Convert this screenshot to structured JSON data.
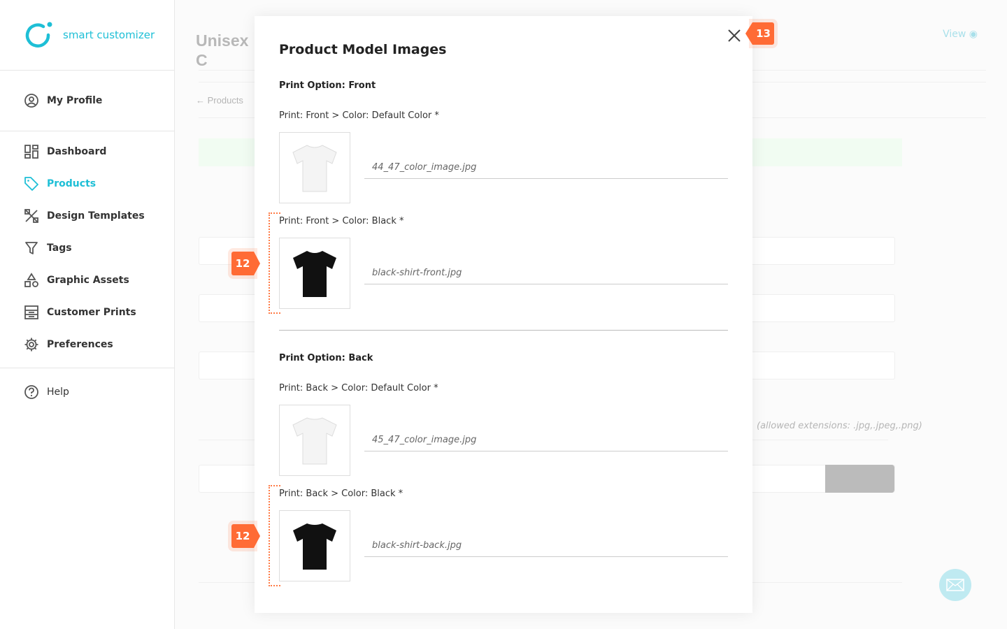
{
  "brand": {
    "name": "smart customizer",
    "accent": "#1ebfd6"
  },
  "sidebar": {
    "profile": {
      "label": "My Profile",
      "icon": "user-circle-icon"
    },
    "items": [
      {
        "label": "Dashboard",
        "icon": "dashboard-icon"
      },
      {
        "label": "Products",
        "icon": "tag-icon",
        "active": true
      },
      {
        "label": "Design Templates",
        "icon": "design-tools-icon"
      },
      {
        "label": "Tags",
        "icon": "filter-icon"
      },
      {
        "label": "Graphic Assets",
        "icon": "shapes-icon"
      },
      {
        "label": "Customer Prints",
        "icon": "prints-icon"
      },
      {
        "label": "Preferences",
        "icon": "gear-icon"
      }
    ],
    "help": {
      "label": "Help",
      "icon": "question-circle-icon"
    }
  },
  "background": {
    "page_title": "Unisex C",
    "view_label": "View",
    "breadcrumb": "Products",
    "hint": "(allowed extensions: .jpg,.jpeg,.png)"
  },
  "modal": {
    "title": "Product Model Images",
    "sections": [
      {
        "title": "Print Option: Front",
        "rows": [
          {
            "label": "Print: Front > Color: Default Color *",
            "filename": "44_47_color_image.jpg",
            "shirt_color": "#f4f4f4"
          },
          {
            "label": "Print: Front > Color: Black *",
            "filename": "black-shirt-front.jpg",
            "shirt_color": "#111111"
          }
        ]
      },
      {
        "title": "Print Option: Back",
        "rows": [
          {
            "label": "Print: Back > Color: Default Color *",
            "filename": "45_47_color_image.jpg",
            "shirt_color": "#f4f4f4"
          },
          {
            "label": "Print: Back > Color: Black *",
            "filename": "black-shirt-back.jpg",
            "shirt_color": "#111111"
          }
        ]
      }
    ]
  },
  "annotations": {
    "close_badge": "13",
    "row_badge_1": "12",
    "row_badge_2": "12",
    "color": "#ff6b35"
  }
}
